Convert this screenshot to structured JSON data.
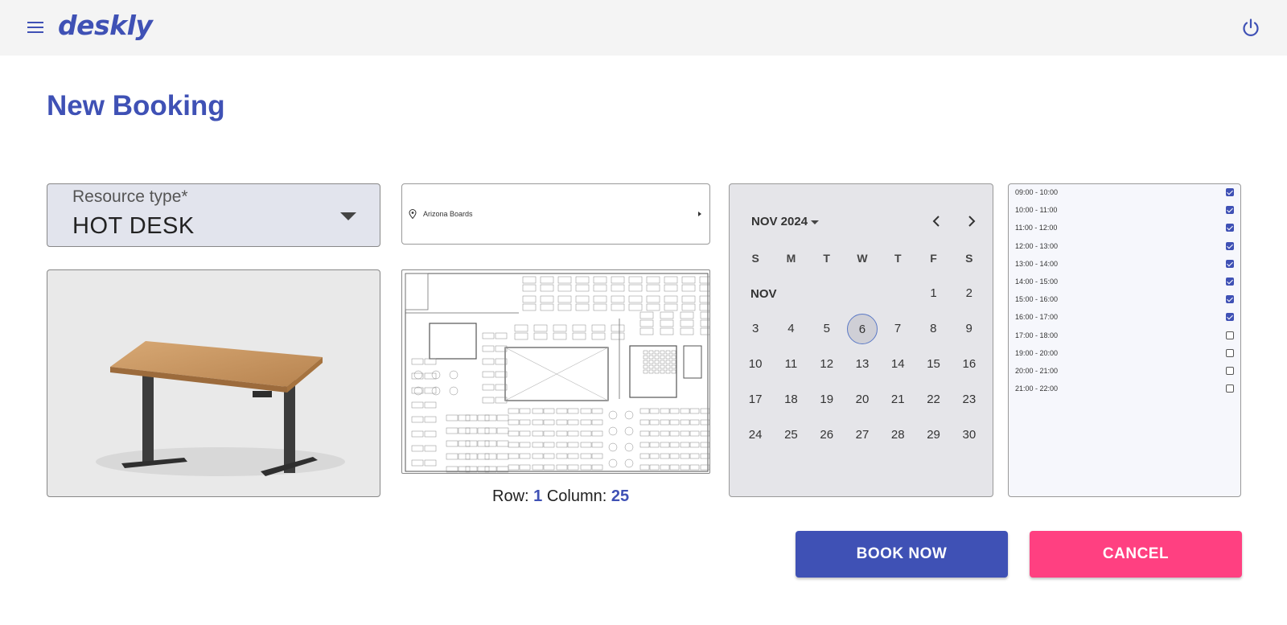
{
  "app": {
    "brand": "deskly"
  },
  "icons": {
    "menu": "hamburger-menu-icon",
    "power": "power-icon",
    "pin": "location-pin-icon"
  },
  "colors": {
    "primary": "#3f51b5",
    "accent": "#ff4081"
  },
  "page": {
    "title": "New Booking"
  },
  "resource": {
    "label": "Resource type*",
    "value": "HOT DESK"
  },
  "location": {
    "value": "Arizona Boards"
  },
  "position": {
    "row_label": "Row:",
    "row": "1",
    "column_label": "Column:",
    "column": "25"
  },
  "calendar": {
    "month": "NOV 2024",
    "month_label": "NOV",
    "weekdays": [
      "S",
      "M",
      "T",
      "W",
      "T",
      "F",
      "S"
    ],
    "selected_day": 6,
    "rows": [
      [
        "",
        "",
        "",
        "",
        "",
        "1",
        "2"
      ],
      [
        "3",
        "4",
        "5",
        "6",
        "7",
        "8",
        "9"
      ],
      [
        "10",
        "11",
        "12",
        "13",
        "14",
        "15",
        "16"
      ],
      [
        "17",
        "18",
        "19",
        "20",
        "21",
        "22",
        "23"
      ],
      [
        "24",
        "25",
        "26",
        "27",
        "28",
        "29",
        "30"
      ]
    ]
  },
  "slots": [
    {
      "label": "09:00 - 10:00",
      "checked": true
    },
    {
      "label": "10:00 - 11:00",
      "checked": true
    },
    {
      "label": "11:00 - 12:00",
      "checked": true
    },
    {
      "label": "12:00 - 13:00",
      "checked": true
    },
    {
      "label": "13:00 - 14:00",
      "checked": true
    },
    {
      "label": "14:00 - 15:00",
      "checked": true
    },
    {
      "label": "15:00 - 16:00",
      "checked": true
    },
    {
      "label": "16:00 - 17:00",
      "checked": true
    },
    {
      "label": "17:00 - 18:00",
      "checked": false
    },
    {
      "label": "19:00 - 20:00",
      "checked": false
    },
    {
      "label": "20:00 - 21:00",
      "checked": false
    },
    {
      "label": "21:00 - 22:00",
      "checked": false
    }
  ],
  "actions": {
    "book": "BOOK NOW",
    "cancel": "CANCEL"
  }
}
